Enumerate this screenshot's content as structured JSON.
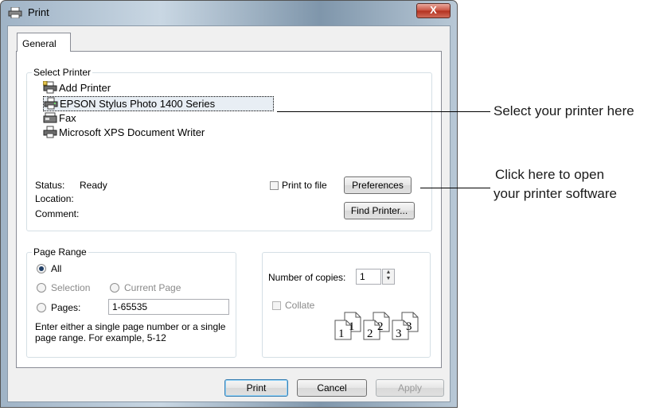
{
  "window": {
    "title": "Print",
    "close_label": "X"
  },
  "tabs": [
    {
      "label": "General"
    }
  ],
  "select_printer": {
    "legend": "Select Printer",
    "printers": [
      {
        "name": "Add Printer",
        "icon": "add-printer-icon"
      },
      {
        "name": "EPSON Stylus Photo 1400 Series",
        "icon": "printer-icon",
        "selected": true
      },
      {
        "name": "Fax",
        "icon": "fax-icon"
      },
      {
        "name": "Microsoft XPS Document Writer",
        "icon": "printer-icon"
      }
    ],
    "status_label": "Status:",
    "status_value": "Ready",
    "location_label": "Location:",
    "comment_label": "Comment:",
    "print_to_file_label": "Print to file",
    "preferences_label": "Preferences",
    "find_printer_label": "Find Printer..."
  },
  "page_range": {
    "legend": "Page Range",
    "all_label": "All",
    "selection_label": "Selection",
    "current_page_label": "Current Page",
    "pages_label": "Pages:",
    "pages_value": "1-65535",
    "help_line1": "Enter either a single page number or a single",
    "help_line2": "page range.  For example, 5-12"
  },
  "copies": {
    "number_label": "Number of copies:",
    "number_value": "1",
    "collate_label": "Collate",
    "collate_pages": [
      "1",
      "1",
      "2",
      "2",
      "3",
      "3"
    ]
  },
  "footer": {
    "print_label": "Print",
    "cancel_label": "Cancel",
    "apply_label": "Apply"
  },
  "callouts": {
    "select_printer": "Select your printer here",
    "open_software_line1": "Click here to open",
    "open_software_line2": "your printer software"
  }
}
